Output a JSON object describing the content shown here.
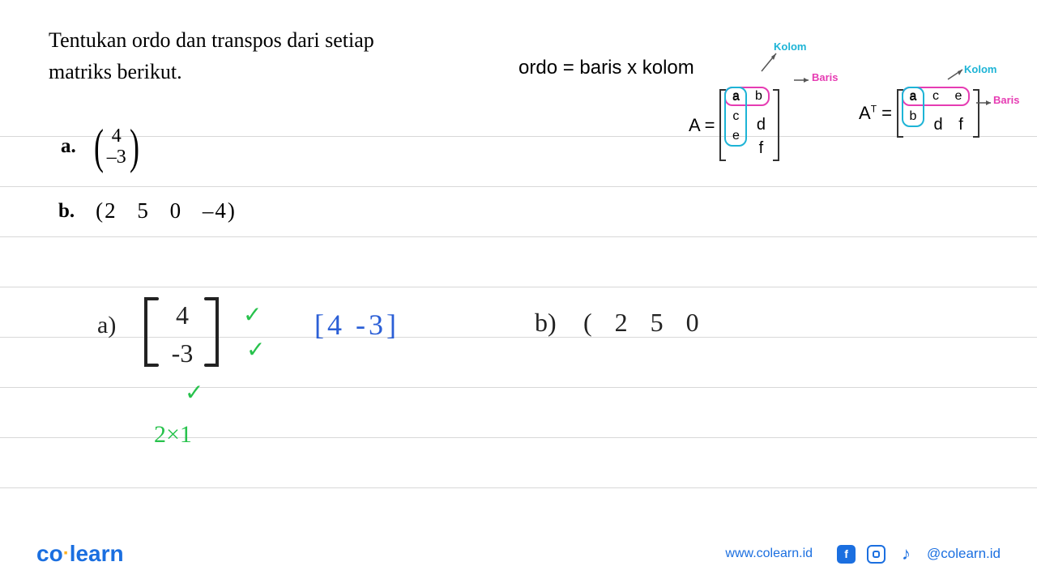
{
  "problem": {
    "text_line1": "Tentukan ordo dan transpos dari setiap",
    "text_line2": "matriks berikut.",
    "formula": "ordo = baris x kolom",
    "item_a_label": "a.",
    "item_a_matrix": {
      "r1": "4",
      "r2": "–3"
    },
    "item_b_label": "b.",
    "item_b_values": {
      "v1": "(2",
      "v2": "5",
      "v3": "0",
      "v4": "–4)"
    }
  },
  "diagrams": {
    "A_eq": "A =",
    "AT_eq": "A",
    "AT_sup": "T",
    "eq": " =",
    "kolom_label": "Kolom",
    "baris_label": "Baris",
    "matA": {
      "r1c1": "a",
      "r1c2": "b",
      "r2c1": "c",
      "r2c2": "d",
      "r3c1": "e",
      "r3c2": "f"
    },
    "matAT": {
      "r1c1": "a",
      "r1c2": "c",
      "r1c3": "e",
      "r2c1": "b",
      "r2c2": "d",
      "r2c3": "f"
    }
  },
  "handwriting": {
    "a_label": "a)",
    "a_matrix_r1": "4",
    "a_matrix_r2": "-3",
    "check": "✓",
    "a_ordo": "2×1",
    "transpose": "[4 -3]",
    "b_label": "b)",
    "b_content": "( 2 5 0"
  },
  "footer": {
    "logo_co": "co",
    "logo_learn": "learn",
    "url": "www.colearn.id",
    "fb": "f",
    "tiktok": "♪",
    "handle": "@colearn.id"
  }
}
